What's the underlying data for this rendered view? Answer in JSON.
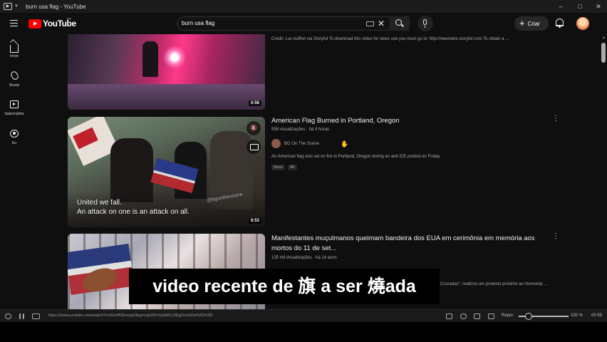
{
  "window": {
    "title": "burn usa flag - YouTube",
    "controls": [
      "–",
      "□",
      "✕"
    ]
  },
  "header": {
    "logo_text": "YouTube",
    "country_code": "PT",
    "search_value": "burn usa flag",
    "create_label": "Criar"
  },
  "sidebar": {
    "items": [
      {
        "label": "Início",
        "icon": "home-icon"
      },
      {
        "label": "Shorts",
        "icon": "shorts-icon"
      },
      {
        "label": "Subscrições",
        "icon": "subscriptions-icon"
      },
      {
        "label": "Eu",
        "icon": "you-icon"
      }
    ]
  },
  "results": [
    {
      "duration": "0:56",
      "description": "Credit: Luc Auffret via Storyful To download this video for news use you must go to: http://newswire.storyful.com To obtain a ..."
    },
    {
      "title": "American Flag Burned in Portland, Oregon",
      "meta": "558 visualizações · há 4 horas",
      "channel": "BG On The Scene",
      "description": "An American flag was set on fire in Portland, Oregon during an anti-ICE protest on Friday.",
      "badges": [
        "Novo",
        "4K"
      ],
      "duration": "8:53",
      "caption_line1": "United we fall.",
      "caption_line2": "An attack on one is an attack on all.",
      "watermark": "@bgonthescene"
    },
    {
      "title": "Manifestantes muçulmanos queimam bandeira dos EUA em cerimônia em memória aos mortos do 11 de set...",
      "meta": "135 mil visualizações · há 14 anos",
      "description": "Cruzadas\", realizou um protesto próximo ao memorial ..."
    }
  ],
  "subtitle_overlay": "video recente de 旗 a ser 燒ada",
  "player": {
    "url": "https://www.youtube.com/watch?v=Z6vPlGEwogO&pp=ygUNYnVybiB1c2EgZmxhZw%3D%3D",
    "repeat_label": "Repor",
    "volume": "100 %",
    "time": "00:59",
    "volume_level": 0.12
  },
  "colors": {
    "background": "#0f0f0f",
    "youtube_red": "#ff0000",
    "text": "#f1f1f1",
    "meta_text": "#aaaaaa"
  }
}
